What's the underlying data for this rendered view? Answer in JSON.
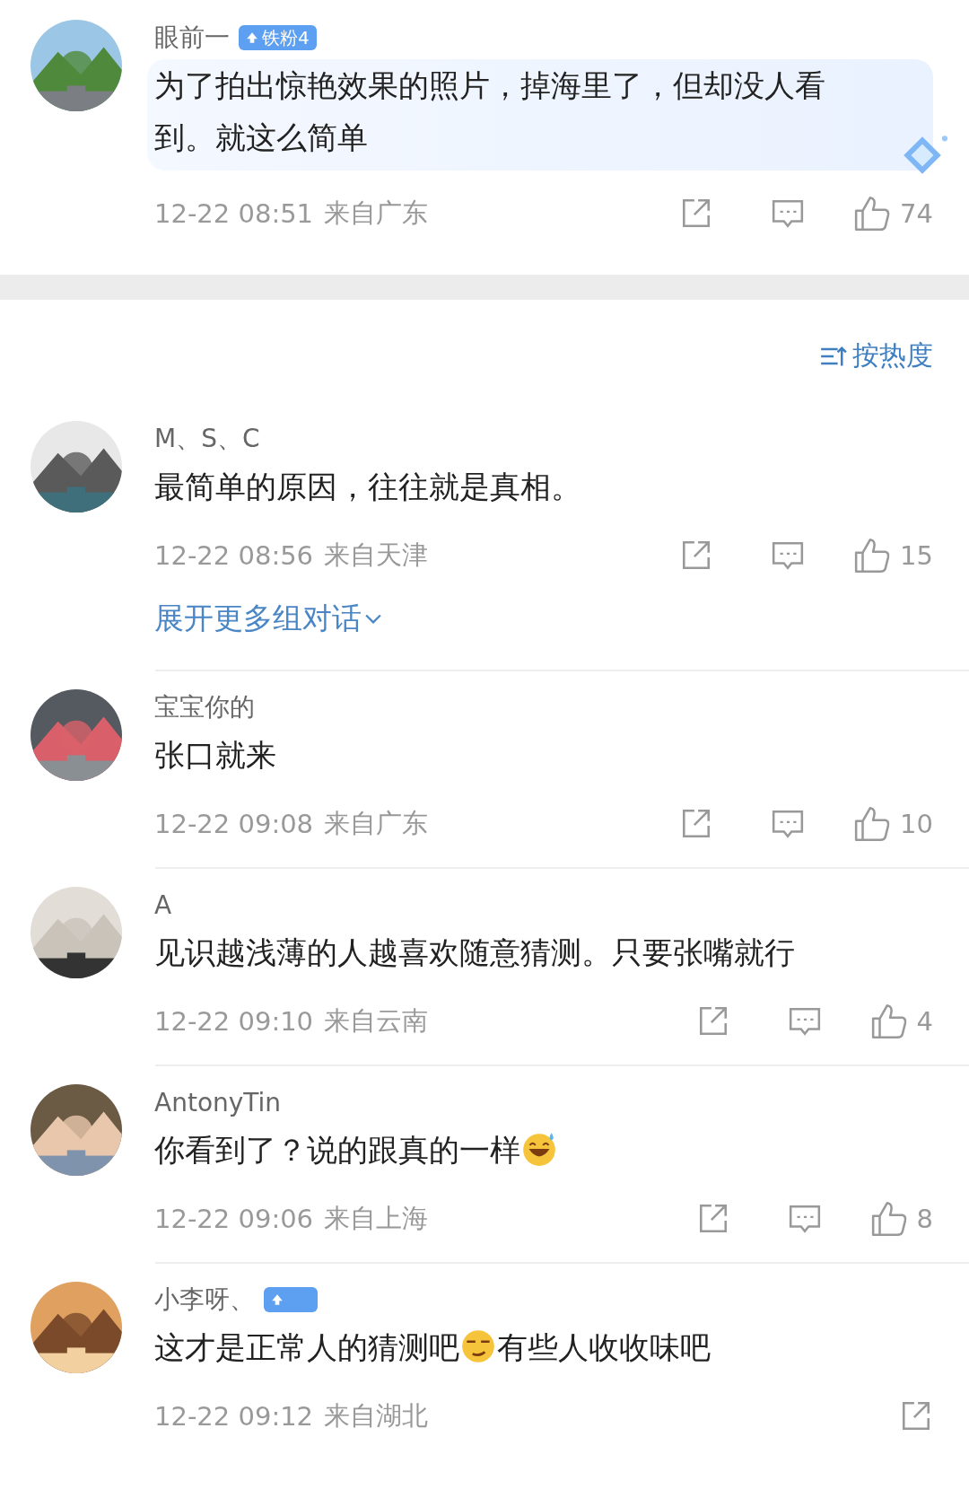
{
  "top_comment": {
    "name": "眼前一",
    "badge": {
      "kind": "fan",
      "label": "铁粉4"
    },
    "highlighted": true,
    "segments": [
      {
        "kind": "text",
        "text": "为了拍出惊艳效果的照片，掉海里了，但却没人看到。就这么简单"
      }
    ],
    "date": "12-22 08:51",
    "location": "来自广东",
    "actions": [
      {
        "kind": "share"
      },
      {
        "kind": "comment"
      },
      {
        "kind": "like"
      }
    ],
    "likes": "74"
  },
  "sort": {
    "label": "按热度"
  },
  "comments": [
    {
      "name": "M、S、C",
      "segments": [
        {
          "kind": "text",
          "text": "最简单的原因，往往就是真相。"
        }
      ],
      "date": "12-22 08:56",
      "location": "来自天津",
      "actions": [
        {
          "kind": "share"
        },
        {
          "kind": "comment"
        },
        {
          "kind": "like"
        }
      ],
      "likes": "15",
      "expand": "展开更多组对话"
    },
    {
      "name": "宝宝你的",
      "segments": [
        {
          "kind": "text",
          "text": "张口就来"
        }
      ],
      "date": "12-22 09:08",
      "location": "来自广东",
      "actions": [
        {
          "kind": "share"
        },
        {
          "kind": "comment"
        },
        {
          "kind": "like"
        }
      ],
      "likes": "10"
    },
    {
      "name": "A",
      "segments": [
        {
          "kind": "text",
          "text": "见识越浅薄的人越喜欢随意猜测。只要张嘴就行"
        }
      ],
      "date": "12-22 09:10",
      "location": "来自云南",
      "actions": [
        {
          "kind": "share"
        },
        {
          "kind": "comment"
        },
        {
          "kind": "like"
        }
      ],
      "likes": "4"
    },
    {
      "name": "AntonyTin",
      "segments": [
        {
          "kind": "text",
          "text": "你看到了？说的跟真的一样"
        },
        {
          "kind": "emoji-sweat"
        }
      ],
      "date": "12-22 09:06",
      "location": "来自上海",
      "actions": [
        {
          "kind": "share"
        },
        {
          "kind": "comment"
        },
        {
          "kind": "like"
        }
      ],
      "likes": "8"
    },
    {
      "name": "小李呀、",
      "badge": {
        "kind": "fan"
      },
      "segments": [
        {
          "kind": "text",
          "text": "这才是正常人的猜测吧"
        },
        {
          "kind": "emoji-smirk"
        },
        {
          "kind": "text",
          "text": "有些人收收味吧"
        }
      ],
      "date": "12-22 09:12",
      "location": "来自湖北",
      "actions": [
        {
          "kind": "share"
        }
      ]
    }
  ]
}
